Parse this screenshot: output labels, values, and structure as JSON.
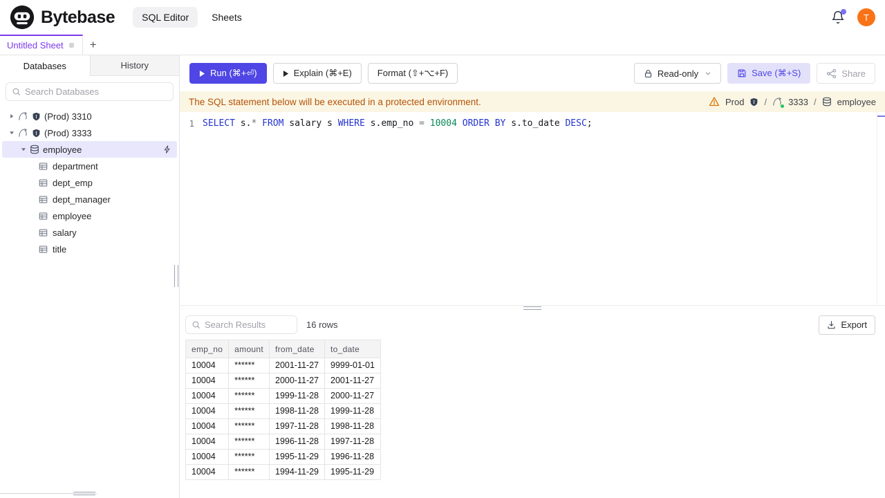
{
  "header": {
    "brand": "Bytebase",
    "nav_sql_editor": "SQL Editor",
    "nav_sheets": "Sheets",
    "avatar_letter": "T"
  },
  "tabbar": {
    "active_tab": "Untitled Sheet",
    "add_button": "+"
  },
  "sidebar": {
    "tab_databases": "Databases",
    "tab_history": "History",
    "search_placeholder": "Search Databases",
    "instances": [
      {
        "label": "(Prod) 3310",
        "expanded": false
      },
      {
        "label": "(Prod) 3333",
        "expanded": true
      }
    ],
    "database": "employee",
    "tables": [
      "department",
      "dept_emp",
      "dept_manager",
      "employee",
      "salary",
      "title"
    ]
  },
  "toolbar": {
    "run": "Run (⌘+⏎)",
    "explain": "Explain (⌘+E)",
    "format": "Format (⇧+⌥+F)",
    "readonly": "Read-only",
    "save": "Save (⌘+S)",
    "share": "Share"
  },
  "banner": {
    "message": "The SQL statement below will be executed in a protected environment.",
    "environment": "Prod",
    "separator": "/",
    "instance": "3333",
    "database": "employee"
  },
  "editor": {
    "line_number": "1",
    "sql": "SELECT s.* FROM salary s WHERE s.emp_no = 10004 ORDER BY s.to_date DESC;",
    "tokens": [
      {
        "text": "SELECT",
        "type": "keyword"
      },
      {
        "text": " s.",
        "type": "plain"
      },
      {
        "text": "*",
        "type": "operator"
      },
      {
        "text": " ",
        "type": "plain"
      },
      {
        "text": "FROM",
        "type": "keyword"
      },
      {
        "text": " salary s ",
        "type": "plain"
      },
      {
        "text": "WHERE",
        "type": "keyword"
      },
      {
        "text": " s.emp_no ",
        "type": "plain"
      },
      {
        "text": "=",
        "type": "operator"
      },
      {
        "text": " ",
        "type": "plain"
      },
      {
        "text": "10004",
        "type": "number"
      },
      {
        "text": " ",
        "type": "plain"
      },
      {
        "text": "ORDER BY",
        "type": "keyword"
      },
      {
        "text": " s.to_date ",
        "type": "plain"
      },
      {
        "text": "DESC",
        "type": "keyword"
      },
      {
        "text": ";",
        "type": "plain"
      }
    ]
  },
  "results": {
    "search_placeholder": "Search Results",
    "row_count": "16 rows",
    "export": "Export",
    "columns": [
      "emp_no",
      "amount",
      "from_date",
      "to_date"
    ],
    "rows": [
      [
        "10004",
        "******",
        "2001-11-27",
        "9999-01-01"
      ],
      [
        "10004",
        "******",
        "2000-11-27",
        "2001-11-27"
      ],
      [
        "10004",
        "******",
        "1999-11-28",
        "2000-11-27"
      ],
      [
        "10004",
        "******",
        "1998-11-28",
        "1999-11-28"
      ],
      [
        "10004",
        "******",
        "1997-11-28",
        "1998-11-28"
      ],
      [
        "10004",
        "******",
        "1996-11-28",
        "1997-11-28"
      ],
      [
        "10004",
        "******",
        "1995-11-29",
        "1996-11-28"
      ],
      [
        "10004",
        "******",
        "1994-11-29",
        "1995-11-29"
      ]
    ]
  },
  "colors": {
    "accent_indigo": "#4f46e5",
    "tab_violet": "#7c3aed",
    "avatar_orange": "#f97316",
    "banner_bg": "#fbf6e3",
    "banner_text": "#b45309",
    "sql_keyword": "#2433d0",
    "sql_number": "#098658",
    "status_green": "#22c55e"
  }
}
